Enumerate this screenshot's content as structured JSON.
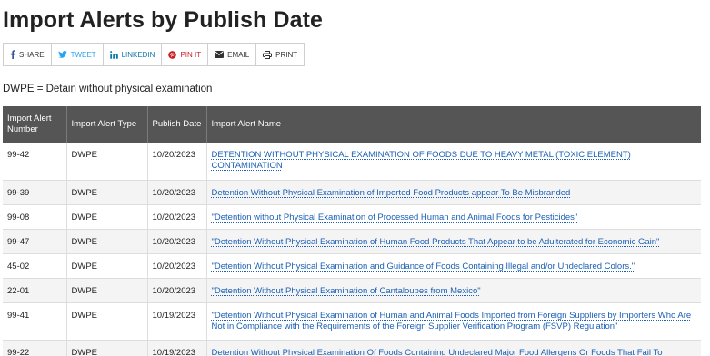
{
  "page": {
    "title": "Import Alerts by Publish Date",
    "note": "DWPE = Detain without physical examination"
  },
  "share": {
    "facebook": "SHARE",
    "twitter": "TWEET",
    "linkedin": "LINKEDIN",
    "pinterest": "PIN IT",
    "email": "EMAIL",
    "print": "PRINT",
    "icons": [
      "facebook-icon",
      "twitter-icon",
      "linkedin-icon",
      "pinterest-icon",
      "email-icon",
      "print-icon"
    ],
    "colors": {
      "twitter": "#2aa3ef",
      "linkedin": "#0e76a8",
      "pinterest": "#cb2027"
    }
  },
  "table": {
    "headers": {
      "number": "Import Alert Number",
      "type": "Import Alert Type",
      "date": "Publish Date",
      "name": "Import Alert Name"
    },
    "header_bg": "#555555",
    "link_color": "#1a5fb4",
    "rows": [
      {
        "number": "99-42",
        "type": "DWPE",
        "date": "10/20/2023",
        "name": "DETENTION WITHOUT PHYSICAL EXAMINATION OF FOODS DUE TO HEAVY METAL (TOXIC ELEMENT) CONTAMINATION"
      },
      {
        "number": "99-39",
        "type": "DWPE",
        "date": "10/20/2023",
        "name": "Detention Without Physical Examination of Imported Food Products appear To Be Misbranded"
      },
      {
        "number": "99-08",
        "type": "DWPE",
        "date": "10/20/2023",
        "name": "\"Detention without Physical Examination of Processed Human and Animal Foods for Pesticides\""
      },
      {
        "number": "99-47",
        "type": "DWPE",
        "date": "10/20/2023",
        "name": "\"Detention Without Physical Examination of Human Food Products That Appear to be Adulterated for Economic Gain\""
      },
      {
        "number": "45-02",
        "type": "DWPE",
        "date": "10/20/2023",
        "name": "\"Detention Without Physical Examination and Guidance of Foods Containing Illegal and/or Undeclared Colors.\""
      },
      {
        "number": "22-01",
        "type": "DWPE",
        "date": "10/20/2023",
        "name": "\"Detention Without Physical Examination of Cantaloupes from Mexico\""
      },
      {
        "number": "99-41",
        "type": "DWPE",
        "date": "10/19/2023",
        "name": "\"Detention Without Physical Examination of Human and Animal Foods Imported from Foreign Suppliers by Importers Who Are Not in Compliance with the Requirements of the Foreign Supplier Verification Program (FSVP) Regulation\""
      },
      {
        "number": "99-22",
        "type": "DWPE",
        "date": "10/19/2023",
        "name": "Detention Without Physical Examination Of Foods Containing Undeclared Major Food Allergens Or Foods That Fail To"
      }
    ]
  }
}
